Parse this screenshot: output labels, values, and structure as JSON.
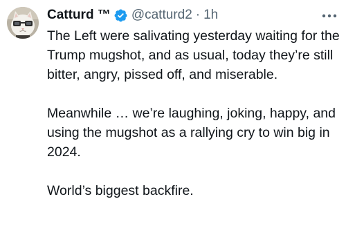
{
  "tweet": {
    "author": {
      "display_name": "Catturd ™",
      "handle": "@catturd2",
      "separator": "·",
      "time": "1h",
      "verified_color": "#1d9bf0",
      "avatar_icon": "cat-with-glasses-avatar"
    },
    "more_icon": "more-options-icon",
    "paragraphs": [
      "The Left were salivating yesterday waiting for the Trump mugshot, and as usual, today they’re still bitter, angry, pissed off, and miserable.",
      "Meanwhile … we’re laughing, joking, happy, and using the mugshot as a rallying cry to win big in 2024.",
      "World’s biggest backfire."
    ]
  }
}
